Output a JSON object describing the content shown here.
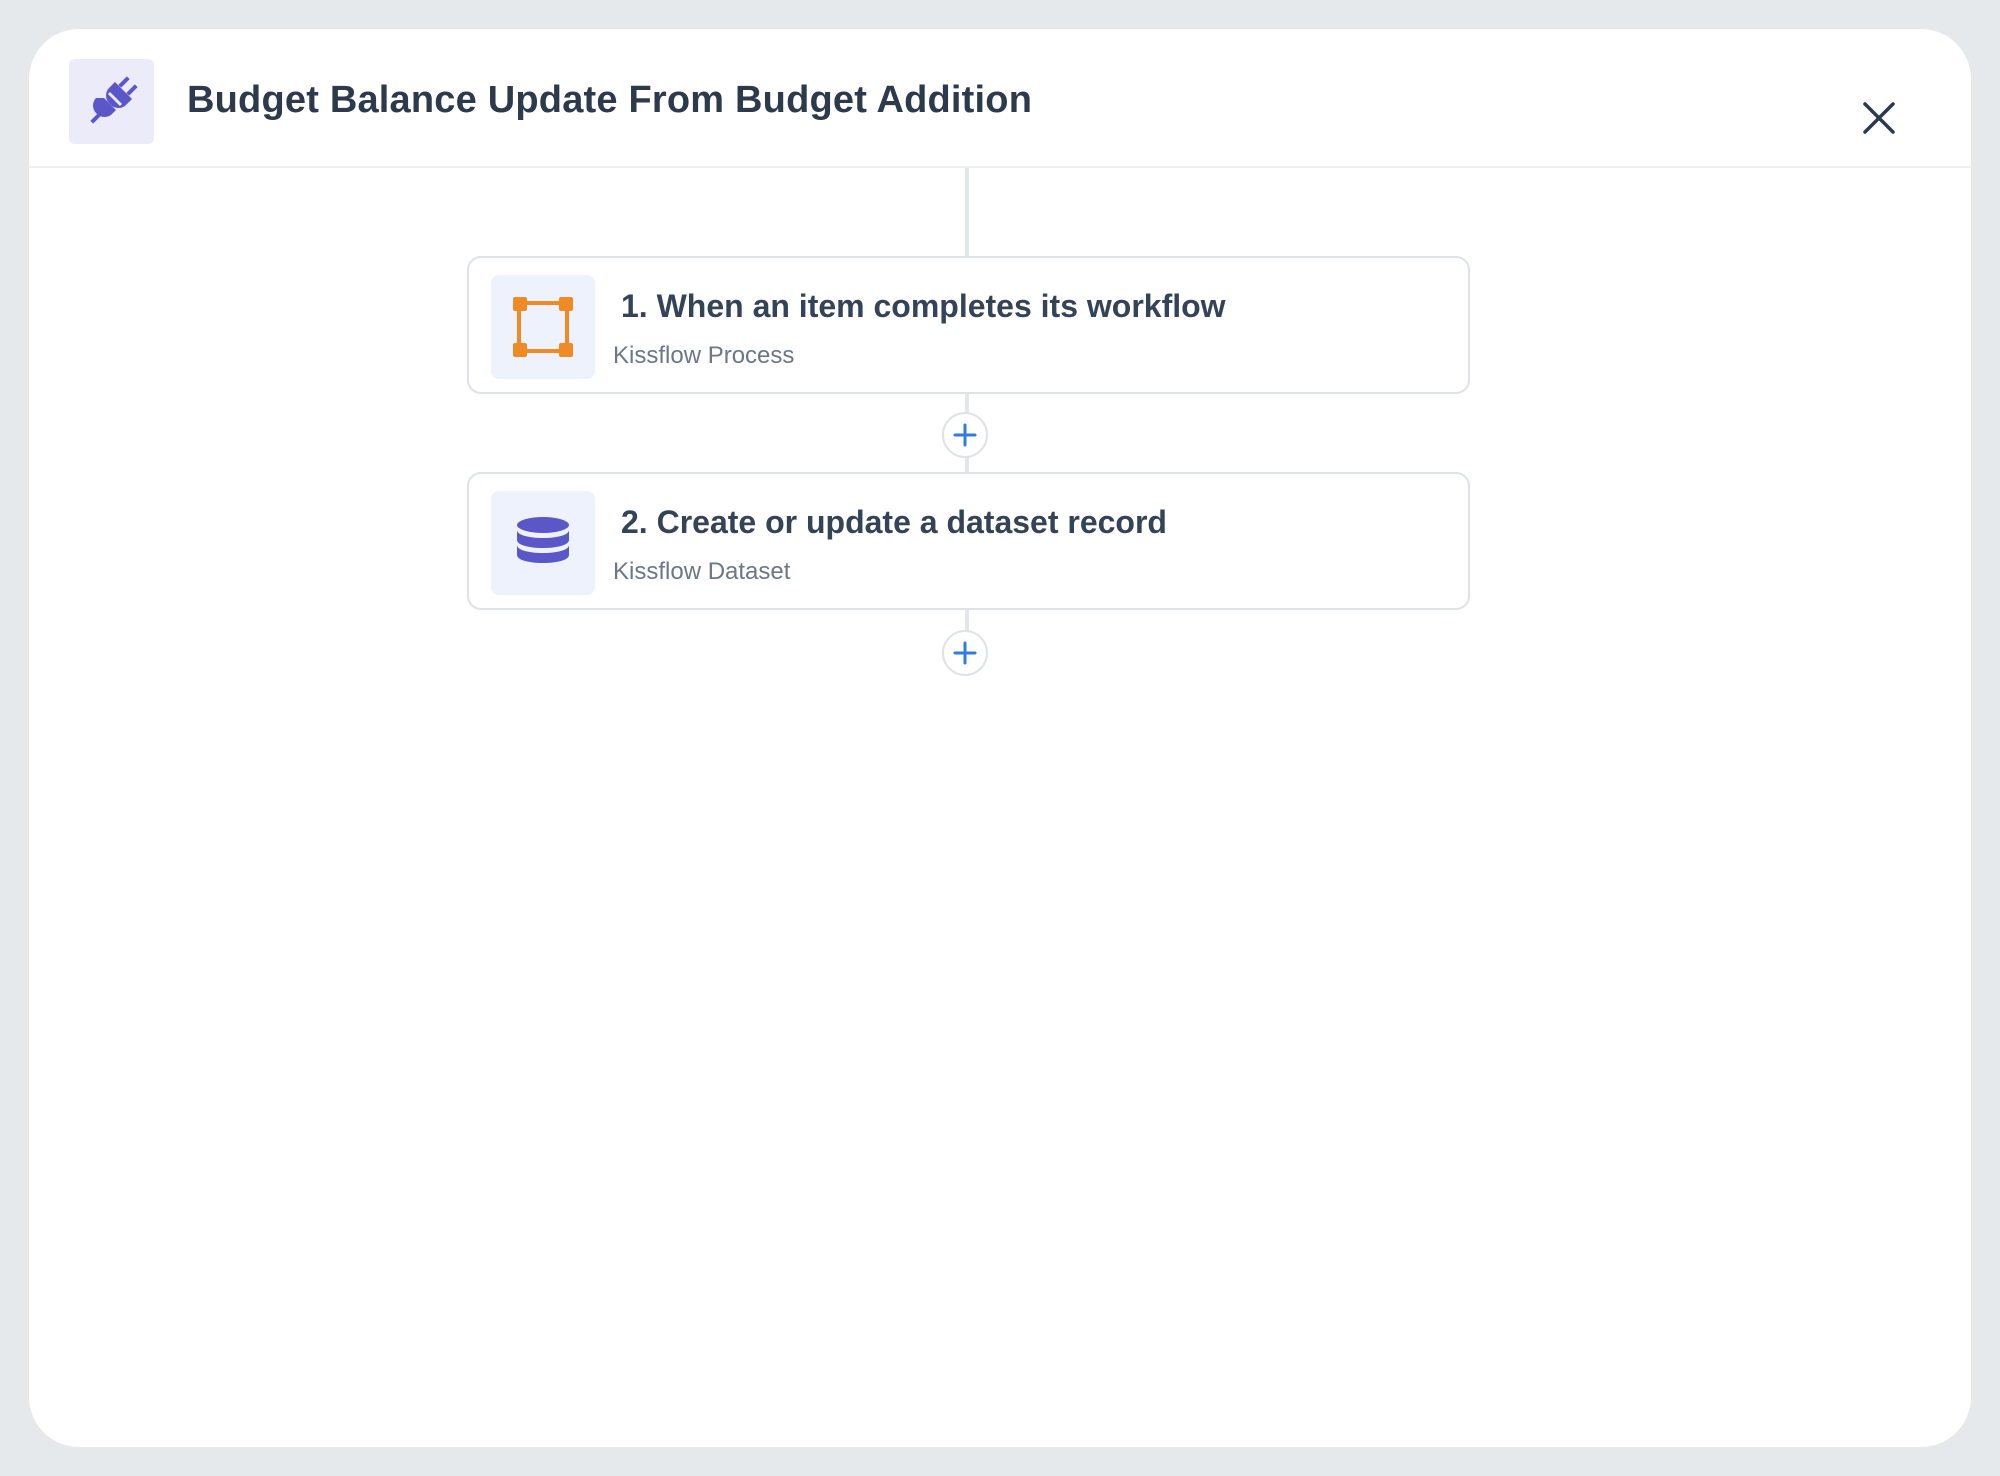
{
  "header": {
    "title": "Budget Balance Update From Budget Addition",
    "app_icon": "plug-icon",
    "close_icon": "close-icon"
  },
  "steps": [
    {
      "number": "1.",
      "title": "When an item completes its workflow",
      "subtitle": "Kissflow Process",
      "icon": "process-icon",
      "icon_color": "#f08a24"
    },
    {
      "number": "2.",
      "title": "Create or update a dataset record",
      "subtitle": "Kissflow Dataset",
      "icon": "database-icon",
      "icon_color": "#5b57c9"
    }
  ],
  "colors": {
    "accent": "#5b57c9",
    "plus": "#2f7ae5"
  }
}
